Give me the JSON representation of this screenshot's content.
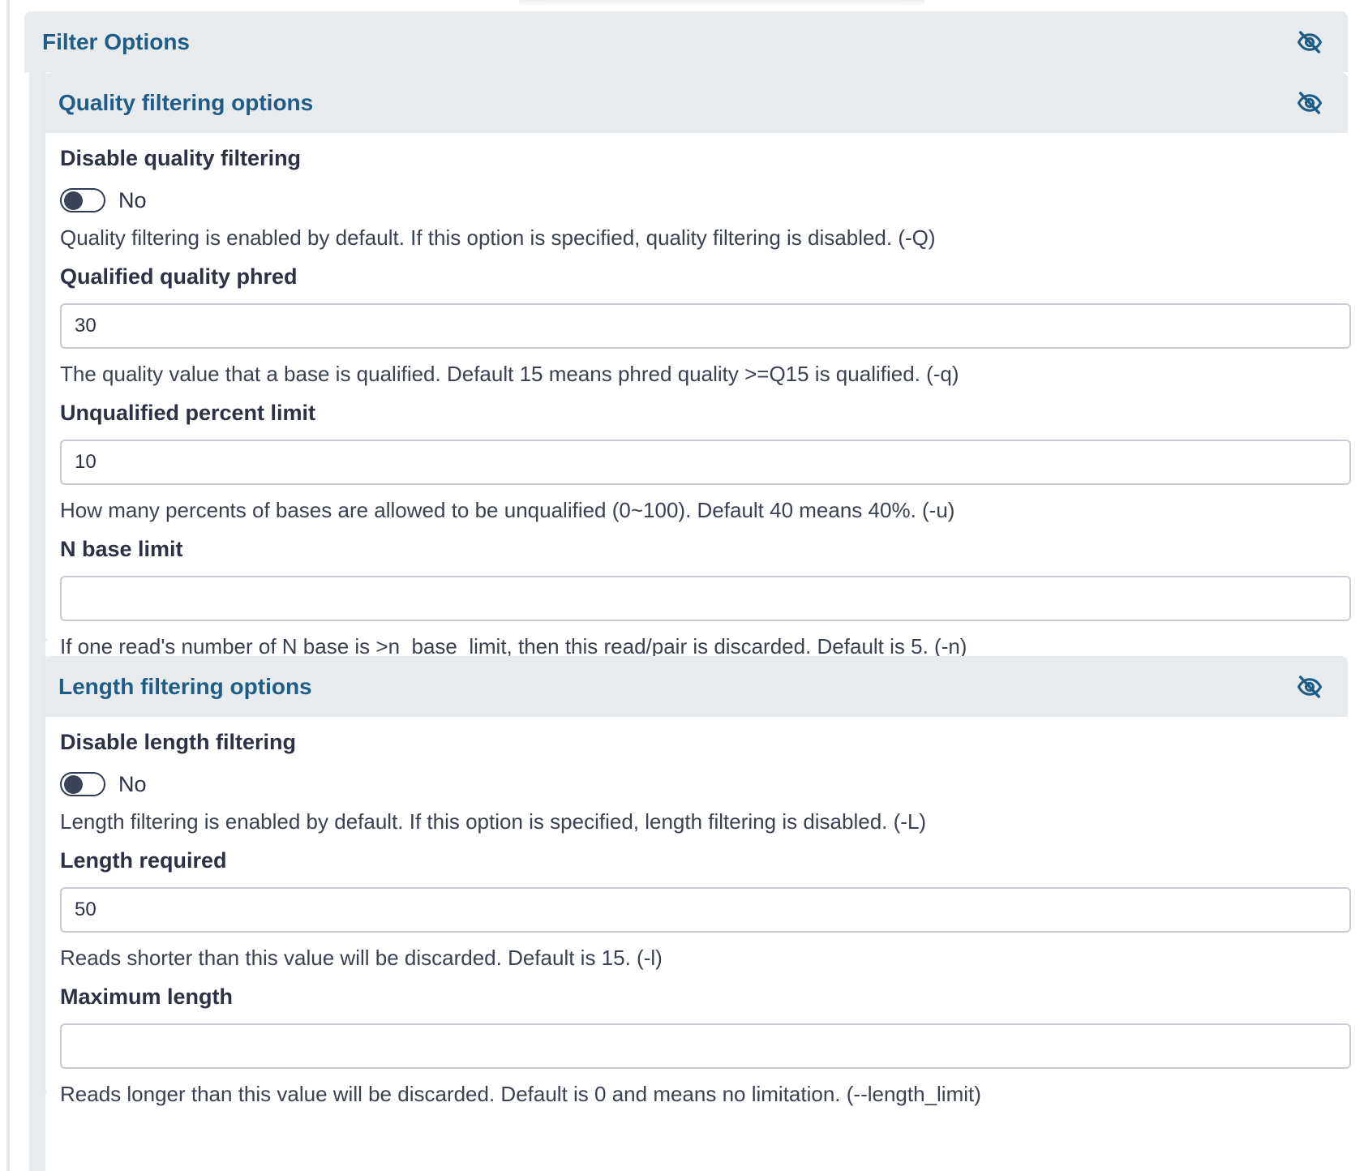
{
  "filter_options": {
    "title": "Filter Options",
    "toggle_icon": "eye-slash-icon"
  },
  "quality": {
    "title": "Quality filtering options",
    "toggle_icon": "eye-slash-icon",
    "disable": {
      "label": "Disable quality filtering",
      "state": "No",
      "help": "Quality filtering is enabled by default. If this option is specified, quality filtering is disabled. (-Q)"
    },
    "qualified_phred": {
      "label": "Qualified quality phred",
      "value": "30",
      "help": "The quality value that a base is qualified. Default 15 means phred quality >=Q15 is qualified. (-q)"
    },
    "unqualified_limit": {
      "label": "Unqualified percent limit",
      "value": "10",
      "help": "How many percents of bases are allowed to be unqualified (0~100). Default 40 means 40%. (-u)"
    },
    "n_base_limit": {
      "label": "N base limit",
      "value": "",
      "help": "If one read's number of N base is >n_base_limit, then this read/pair is discarded. Default is 5. (-n)"
    }
  },
  "length": {
    "title": "Length filtering options",
    "toggle_icon": "eye-slash-icon",
    "disable": {
      "label": "Disable length filtering",
      "state": "No",
      "help": "Length filtering is enabled by default. If this option is specified, length filtering is disabled. (-L)"
    },
    "required": {
      "label": "Length required",
      "value": "50",
      "help": "Reads shorter than this value will be discarded. Default is 15. (-l)"
    },
    "maximum": {
      "label": "Maximum length",
      "value": "",
      "help": "Reads longer than this value will be discarded. Default is 0 and means no limitation. (--length_limit)"
    }
  },
  "colors": {
    "header_bg": "#e8ebee",
    "title_blue": "#1f5d87",
    "text": "#2c3143"
  }
}
